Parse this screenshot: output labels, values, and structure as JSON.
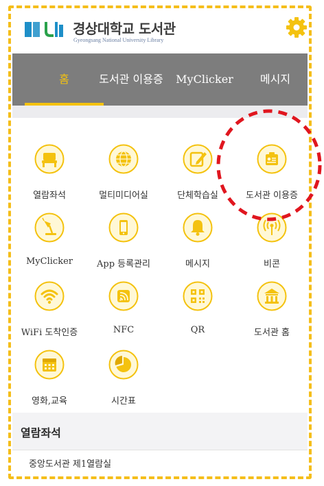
{
  "header": {
    "logo_title": "경상대학교 도서관",
    "logo_subtitle": "Gyeongsang National University Library"
  },
  "tabs": [
    {
      "label": "홈",
      "active": true
    },
    {
      "label": "도서관 이용증",
      "active": false
    },
    {
      "label": "MyClicker",
      "active": false
    },
    {
      "label": "메시지",
      "active": false
    }
  ],
  "menu": [
    {
      "label": "열람좌석",
      "icon": "seat-icon"
    },
    {
      "label": "멀티미디어실",
      "icon": "globe-icon"
    },
    {
      "label": "단체학습실",
      "icon": "pencil-note-icon"
    },
    {
      "label": "도서관 이용증",
      "icon": "id-card-icon"
    },
    {
      "label": "MyClicker",
      "icon": "desk-lamp-icon"
    },
    {
      "label": "App 등록관리",
      "icon": "smartphone-icon"
    },
    {
      "label": "메시지",
      "icon": "bell-icon"
    },
    {
      "label": "비콘",
      "icon": "beacon-icon"
    },
    {
      "label": "WiFi 도착인증",
      "icon": "wifi-icon"
    },
    {
      "label": "NFC",
      "icon": "nfc-icon"
    },
    {
      "label": "QR",
      "icon": "qr-code-icon"
    },
    {
      "label": "도서관 홈",
      "icon": "library-building-icon"
    },
    {
      "label": "영화,교육",
      "icon": "calendar-icon"
    },
    {
      "label": "시간표",
      "icon": "pie-chart-icon"
    }
  ],
  "section": {
    "title": "열람좌석",
    "rows": [
      "중앙도서관 제1열람실"
    ]
  },
  "colors": {
    "accent": "#f4c20f",
    "tab_bar": "#7d7d7d",
    "frame": "#f5be1a",
    "callout": "#e0161f"
  }
}
